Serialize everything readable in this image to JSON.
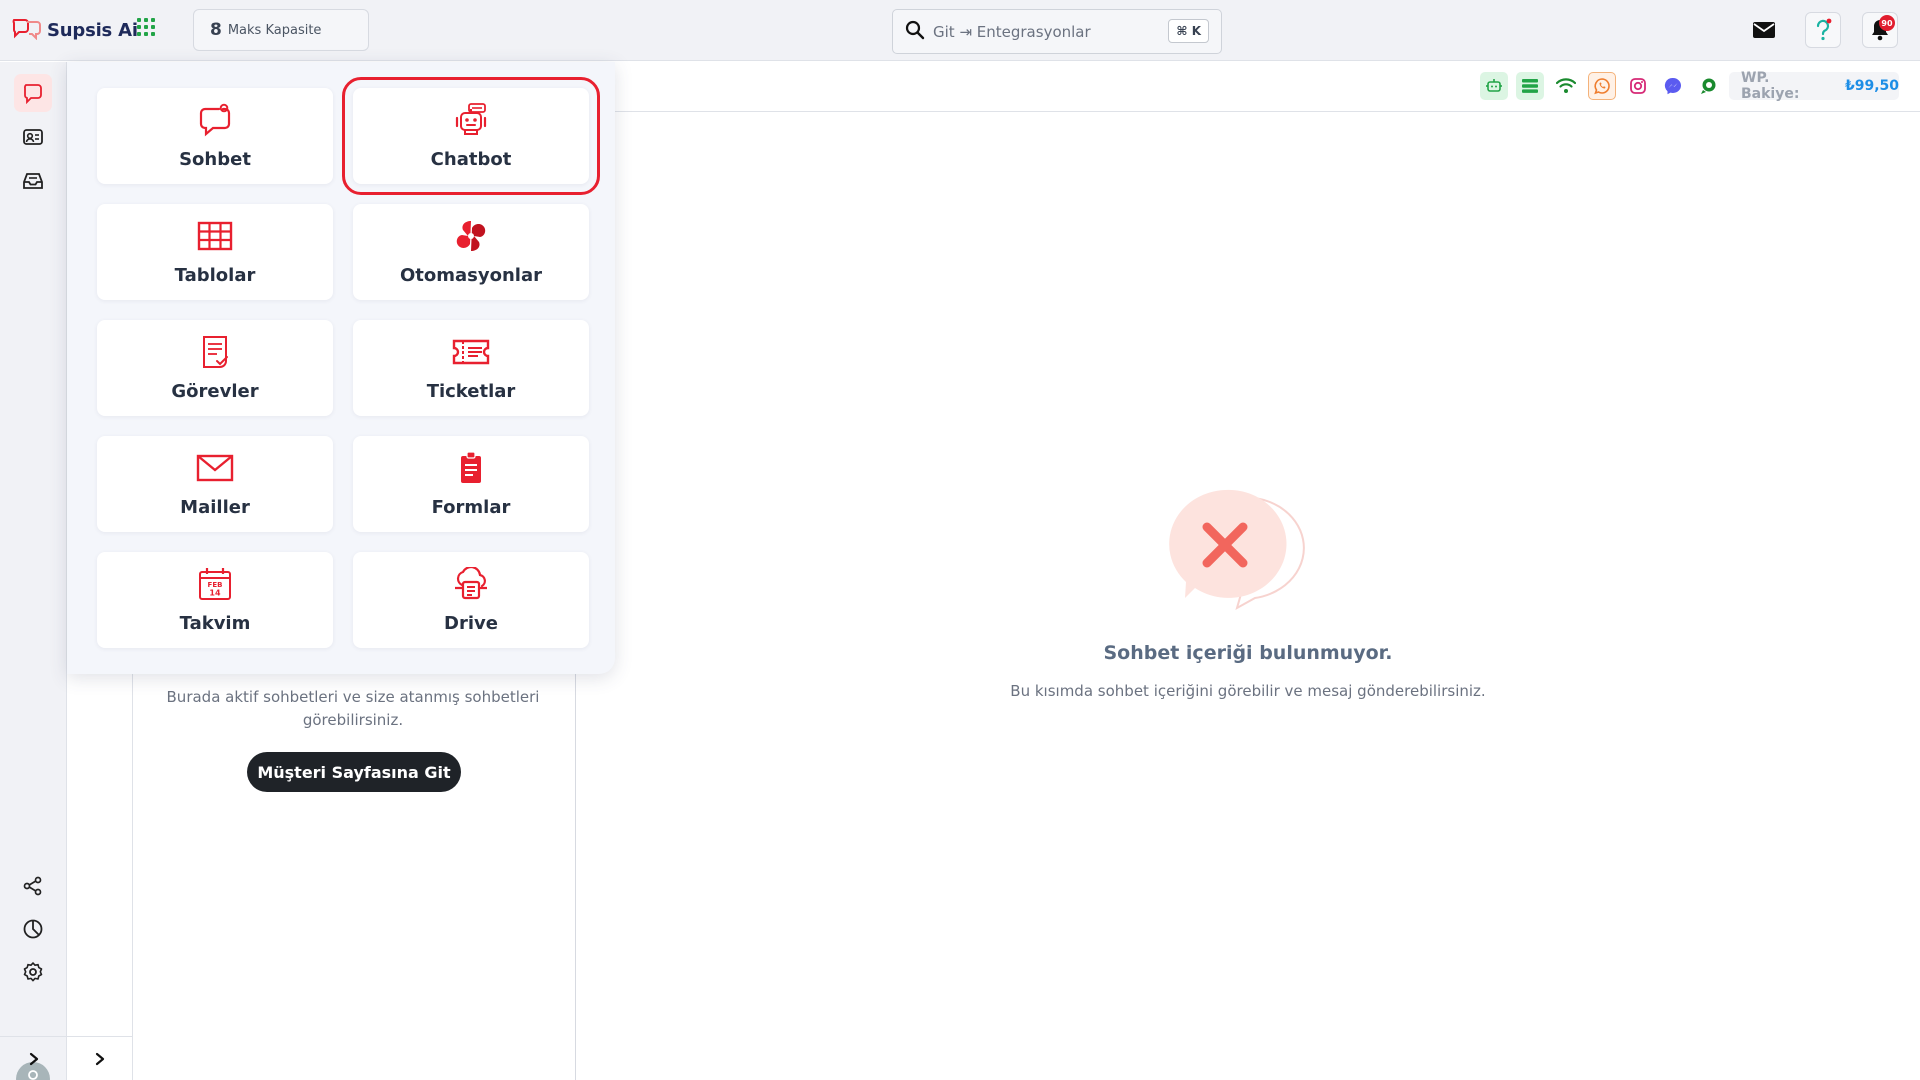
{
  "brand": {
    "name": "Supsis Ai"
  },
  "capacity": {
    "number": "8",
    "label": "Maks Kapasite"
  },
  "search": {
    "placeholder": "Git ⇥ Entegrasyonlar",
    "shortcut": "⌘ K"
  },
  "notifications": {
    "count": "90"
  },
  "apps": [
    {
      "label": "Sohbet",
      "icon": "chat-icon"
    },
    {
      "label": "Chatbot",
      "icon": "robot-icon"
    },
    {
      "label": "Tablolar",
      "icon": "table-icon"
    },
    {
      "label": "Otomasyonlar",
      "icon": "automation-icon"
    },
    {
      "label": "Görevler",
      "icon": "task-icon"
    },
    {
      "label": "Ticketlar",
      "icon": "ticket-icon"
    },
    {
      "label": "Mailler",
      "icon": "mail-icon"
    },
    {
      "label": "Formlar",
      "icon": "form-icon"
    },
    {
      "label": "Takvim",
      "icon": "calendar-icon",
      "date": {
        "month": "FEB",
        "day": "14"
      }
    },
    {
      "label": "Drive",
      "icon": "drive-icon"
    }
  ],
  "highlighted_app": "Chatbot",
  "channels": [
    "chatbot-icon",
    "list-icon",
    "wifi-icon",
    "whatsapp-icon",
    "instagram-icon",
    "messenger-icon",
    "telegram-like-icon"
  ],
  "balance": {
    "label": "WP. Bakiye:",
    "value": "₺99,50"
  },
  "list_panel": {
    "description": "Burada aktif sohbetleri ve size atanmış sohbetleri görebilirsiniz.",
    "button": "Müşteri Sayfasına Git"
  },
  "empty_state": {
    "title": "Sohbet içeriği bulunmuyor.",
    "subtitle": "Bu kısımda sohbet içeriğini görebilir ve mesaj gönderebilirsiniz."
  },
  "colors": {
    "accent": "#e8202f",
    "brand_dark": "#1e2a5a",
    "balance": "#1d8ee6",
    "apps_grid": "#22a447"
  }
}
